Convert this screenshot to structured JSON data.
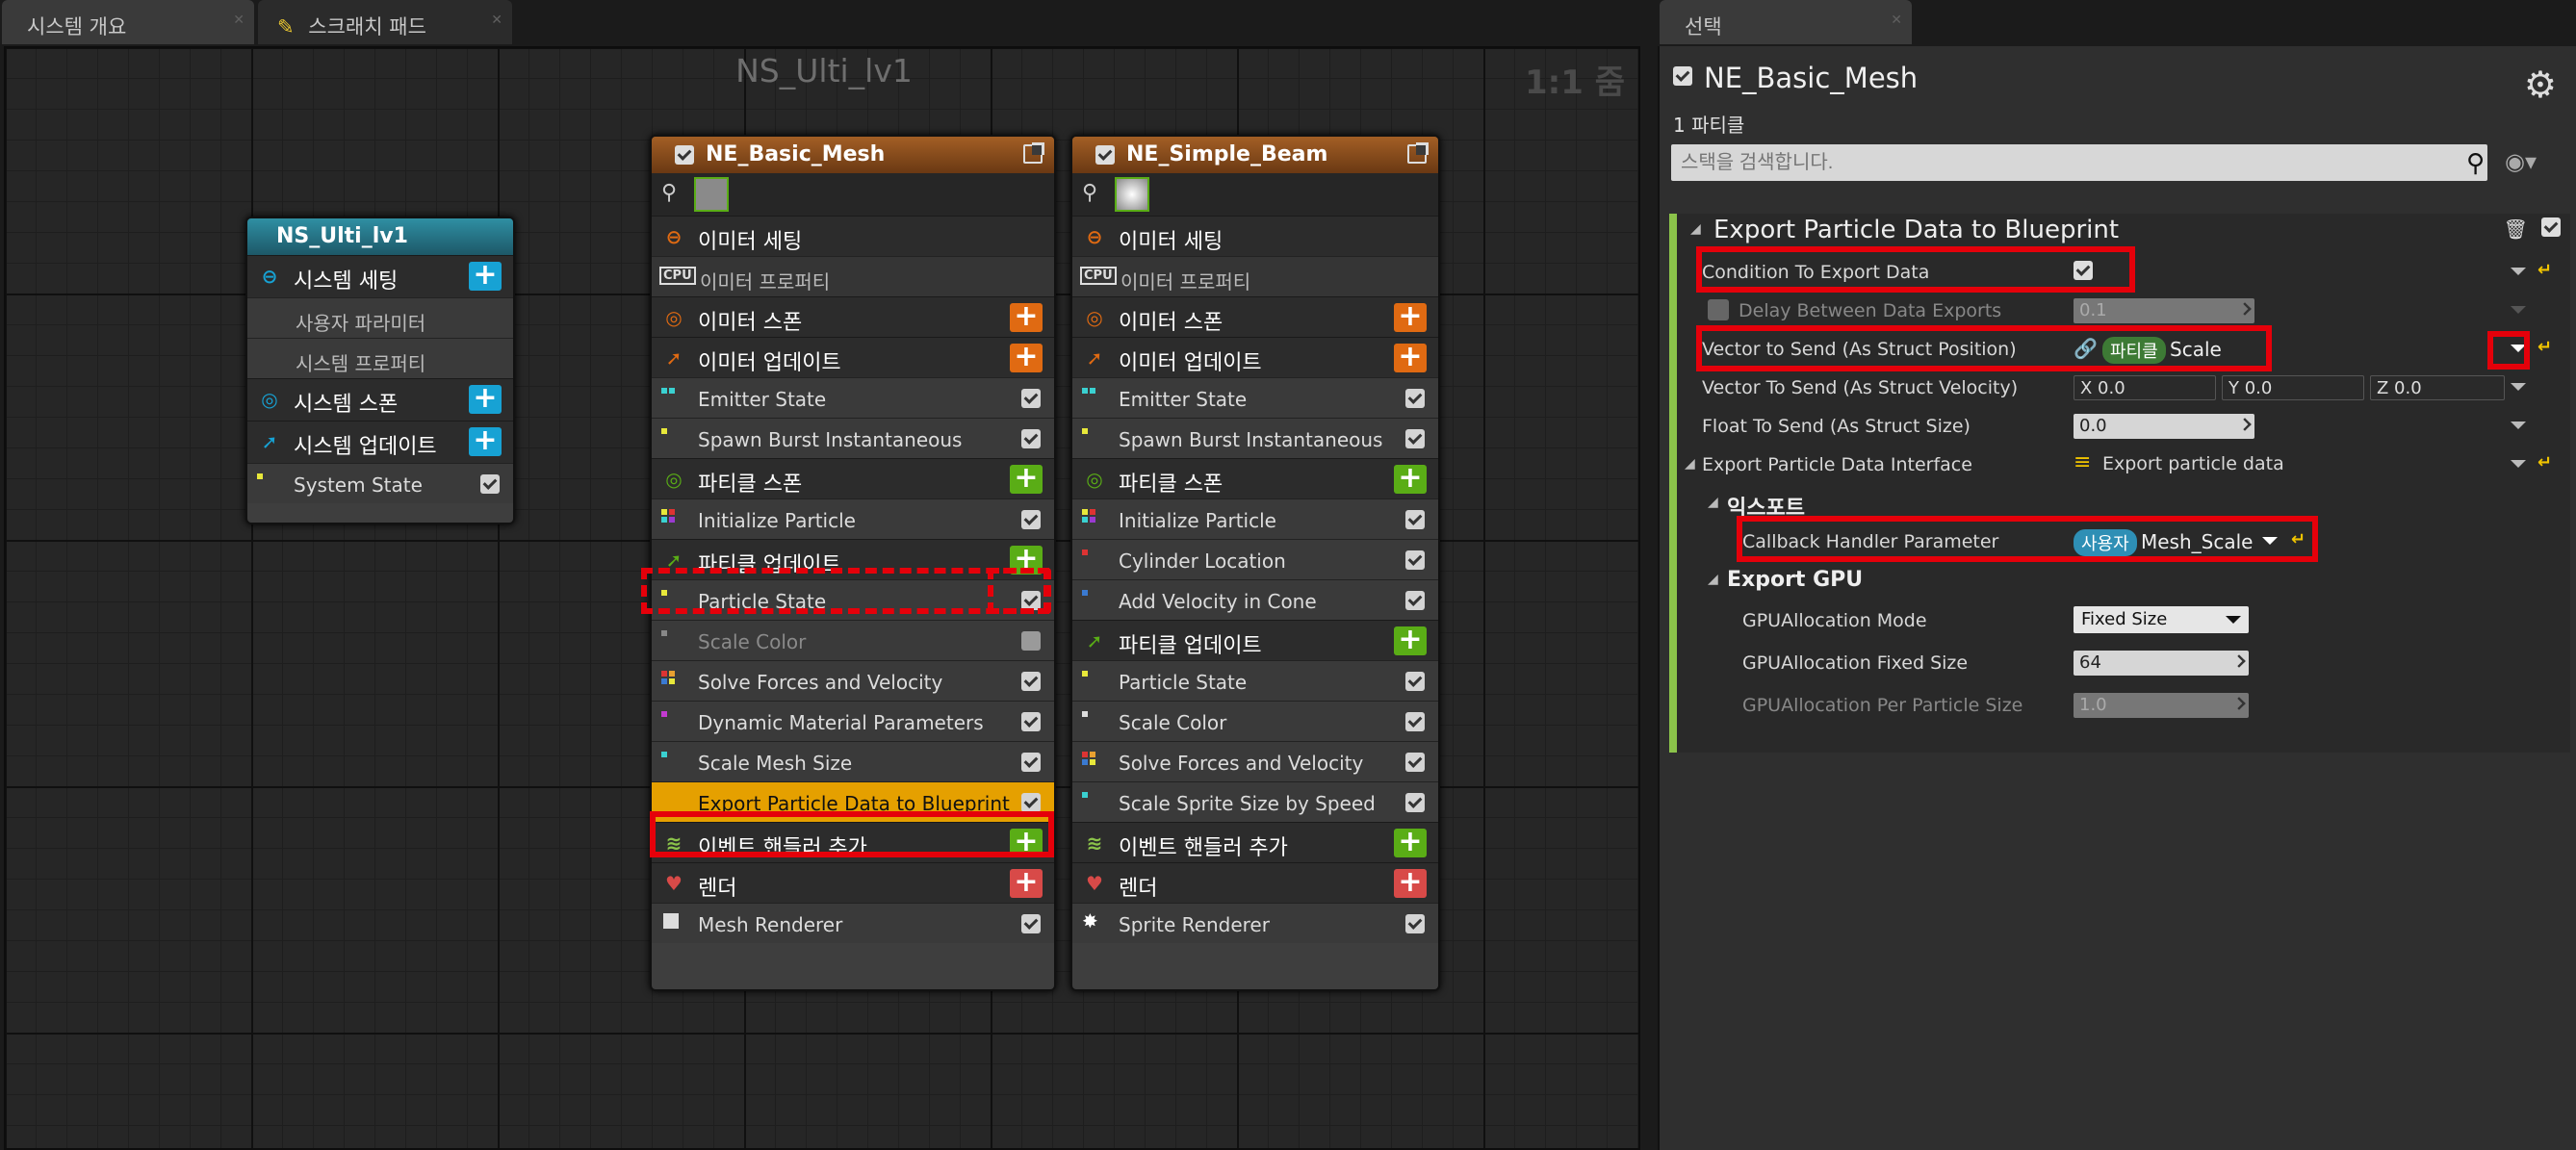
{
  "tabs": {
    "overview": "시스템 개요",
    "scratch": "스크래치 패드",
    "selection": "선택"
  },
  "graph": {
    "title": "NS_Ulti_lv1",
    "zoom": "1:1 줌"
  },
  "system_node": {
    "title": "NS_Ulti_lv1",
    "settings": "시스템 세팅",
    "user_params": "사용자 파라미터",
    "sys_props": "시스템 프로퍼티",
    "spawn": "시스템 스폰",
    "update": "시스템 업데이트",
    "state": "System State"
  },
  "emitter1": {
    "title": "NE_Basic_Mesh",
    "emitter_settings": "이미터 세팅",
    "emitter_props": "이미터 프로퍼티",
    "emitter_spawn": "이미터 스폰",
    "emitter_update": "이미터 업데이트",
    "emitter_state": "Emitter State",
    "spawn_burst": "Spawn Burst Instantaneous",
    "particle_spawn": "파티클 스폰",
    "init_particle": "Initialize Particle",
    "particle_update": "파티클 업데이트",
    "particle_state": "Particle State",
    "scale_color": "Scale Color",
    "solve_forces": "Solve Forces and Velocity",
    "dyn_mat": "Dynamic Material Parameters",
    "scale_mesh": "Scale Mesh Size",
    "export": "Export Particle Data to Blueprint",
    "add_event": "이벤트 핸들러 추가",
    "render": "렌더",
    "renderer": "Mesh Renderer"
  },
  "emitter2": {
    "title": "NE_Simple_Beam",
    "emitter_settings": "이미터 세팅",
    "emitter_props": "이미터 프로퍼티",
    "emitter_spawn": "이미터 스폰",
    "emitter_update": "이미터 업데이트",
    "emitter_state": "Emitter State",
    "spawn_burst": "Spawn Burst Instantaneous",
    "particle_spawn": "파티클 스폰",
    "init_particle": "Initialize Particle",
    "cyl_loc": "Cylinder Location",
    "add_vel": "Add Velocity in Cone",
    "particle_update": "파티클 업데이트",
    "particle_state": "Particle State",
    "scale_color": "Scale Color",
    "solve_forces": "Solve Forces and Velocity",
    "scale_sprite": "Scale Sprite Size by Speed",
    "add_event": "이벤트 핸들러 추가",
    "render": "렌더",
    "renderer": "Sprite Renderer"
  },
  "panel": {
    "title": "NE_Basic_Mesh",
    "count": "1 파티클",
    "search_placeholder": "스택을 검색합니다.",
    "module_title": "Export Particle Data to Blueprint",
    "condition_label": "Condition To Export Data",
    "delay_label": "Delay Between Data Exports",
    "delay_value": "0.1",
    "vec_pos_label": "Vector to Send (As Struct Position)",
    "vec_pos_tag": "파티클",
    "vec_pos_value": "Scale",
    "vec_vel_label": "Vector To Send (As Struct Velocity)",
    "vx": "X 0.0",
    "vy": "Y 0.0",
    "vz": "Z 0.0",
    "float_label": "Float To Send (As Struct Size)",
    "float_value": "0.0",
    "epdi_label": "Export Particle Data Interface",
    "epdi_value": "Export particle data",
    "export_section": "익스포트",
    "callback_label": "Callback Handler Parameter",
    "callback_tag": "사용자",
    "callback_value": "Mesh_Scale",
    "gpu_section": "Export GPU",
    "gpu_mode_label": "GPUAllocation Mode",
    "gpu_mode_value": "Fixed Size",
    "gpu_fixed_label": "GPUAllocation Fixed Size",
    "gpu_fixed_value": "64",
    "gpu_per_label": "GPUAllocation Per Particle Size",
    "gpu_per_value": "1.0"
  },
  "colors": {
    "accent_orange": "#e06a12",
    "accent_green": "#5aad16",
    "accent_blue": "#17a2d4",
    "highlight_red": "#e5000a",
    "selected_module": "#e5a000"
  }
}
